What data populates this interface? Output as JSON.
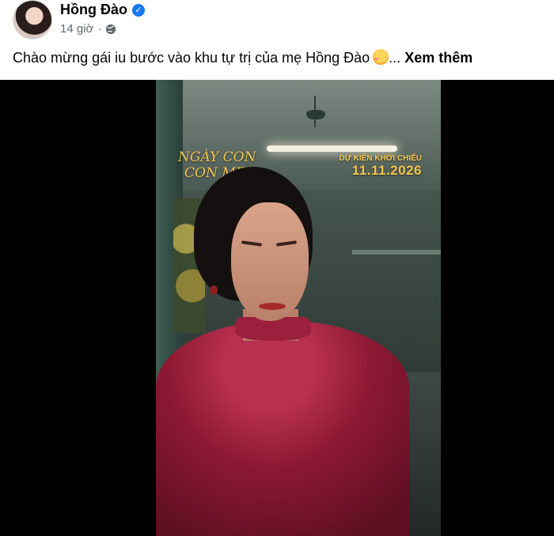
{
  "post": {
    "author": "Hồng Đào",
    "time": "14 giờ",
    "dot": "·",
    "caption": "Chào mừng gái iu bước vào khu tự trị của mẹ Hồng Đào",
    "ellipsis": "...",
    "see_more": "Xem thêm",
    "verified_icon": "verified-badge-icon",
    "audience_icon": "globe-icon"
  },
  "video": {
    "title_line1": "NGÀY CON",
    "title_line2": "CON MẸ",
    "release_label": "DỰ KIẾN KHỞI CHIẾU",
    "release_date": "11.11.2026"
  },
  "colors": {
    "accent": "#1877f2",
    "secondary_text": "#65676b",
    "poster_gold": "#f3c74c"
  }
}
